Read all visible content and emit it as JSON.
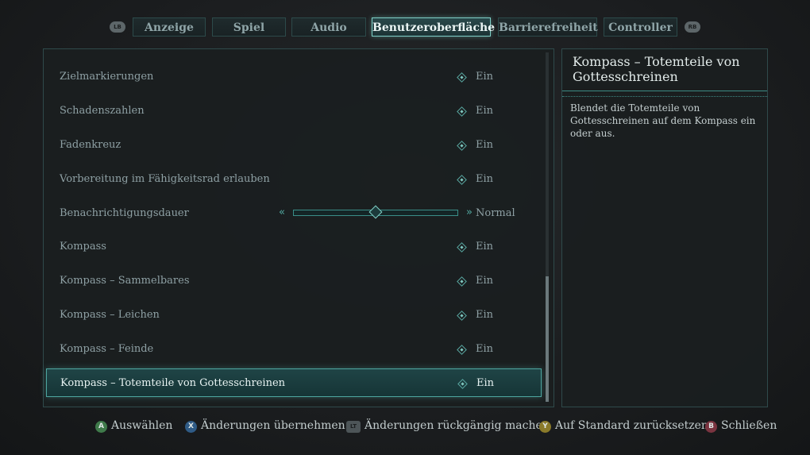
{
  "tabs": {
    "left_bumper": "LB",
    "right_bumper": "RB",
    "items": [
      {
        "label": "Anzeige"
      },
      {
        "label": "Spiel"
      },
      {
        "label": "Audio"
      },
      {
        "label": "Benutzeroberfläche"
      },
      {
        "label": "Barrierefreiheit"
      },
      {
        "label": "Controller"
      }
    ],
    "active_index": 3
  },
  "settings": [
    {
      "label": "Zielmarkierungen",
      "value": "Ein"
    },
    {
      "label": "Schadenszahlen",
      "value": "Ein"
    },
    {
      "label": "Fadenkreuz",
      "value": "Ein"
    },
    {
      "label": "Vorbereitung im Fähigkeitsrad erlauben",
      "value": "Ein"
    },
    {
      "label": "Benachrichtigungsdauer",
      "value": "Normal",
      "slider_fraction": 0.5
    },
    {
      "label": "Kompass",
      "value": "Ein"
    },
    {
      "label": "Kompass – Sammelbares",
      "value": "Ein"
    },
    {
      "label": "Kompass – Leichen",
      "value": "Ein"
    },
    {
      "label": "Kompass – Feinde",
      "value": "Ein"
    },
    {
      "label": "Kompass – Totemteile von Gottesschreinen",
      "value": "Ein",
      "selected": true
    }
  ],
  "scroll": {
    "thumb_start_fraction": 0.64,
    "thumb_size_fraction": 0.36
  },
  "description": {
    "title": "Kompass – Totemteile von Gottesschreinen",
    "text": "Blendet die Totemteile von Gottesschreinen auf dem Kompass ein oder aus."
  },
  "hints": [
    {
      "glyph": "A",
      "color": "#3f7a4a",
      "label": "Auswählen"
    },
    {
      "glyph": "X",
      "color": "#2f5b86",
      "label": "Änderungen übernehmen"
    },
    {
      "glyph": "LT",
      "color": "#4d5558",
      "label": "Änderungen rückgängig machen"
    },
    {
      "glyph": "Y",
      "color": "#8a7a2a",
      "label": "Auf Standard zurücksetzen"
    },
    {
      "glyph": "B",
      "color": "#7a3440",
      "label": "Schließen"
    }
  ],
  "colors": {
    "accent": "#7fd0c8",
    "selected_row": "#1f4446"
  }
}
